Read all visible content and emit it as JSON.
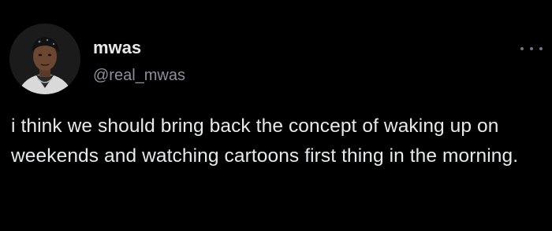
{
  "tweet": {
    "display_name": "mwas",
    "handle": "@real_mwas",
    "text": "i think we should bring back the concept of waking up on weekends and watching cartoons first thing in the morning.",
    "avatar_icon": "profile-photo-icon",
    "more_icon": "more-options-icon"
  },
  "colors": {
    "background": "#000000",
    "text_primary": "#e7e9ea",
    "text_secondary": "#8b9196"
  }
}
